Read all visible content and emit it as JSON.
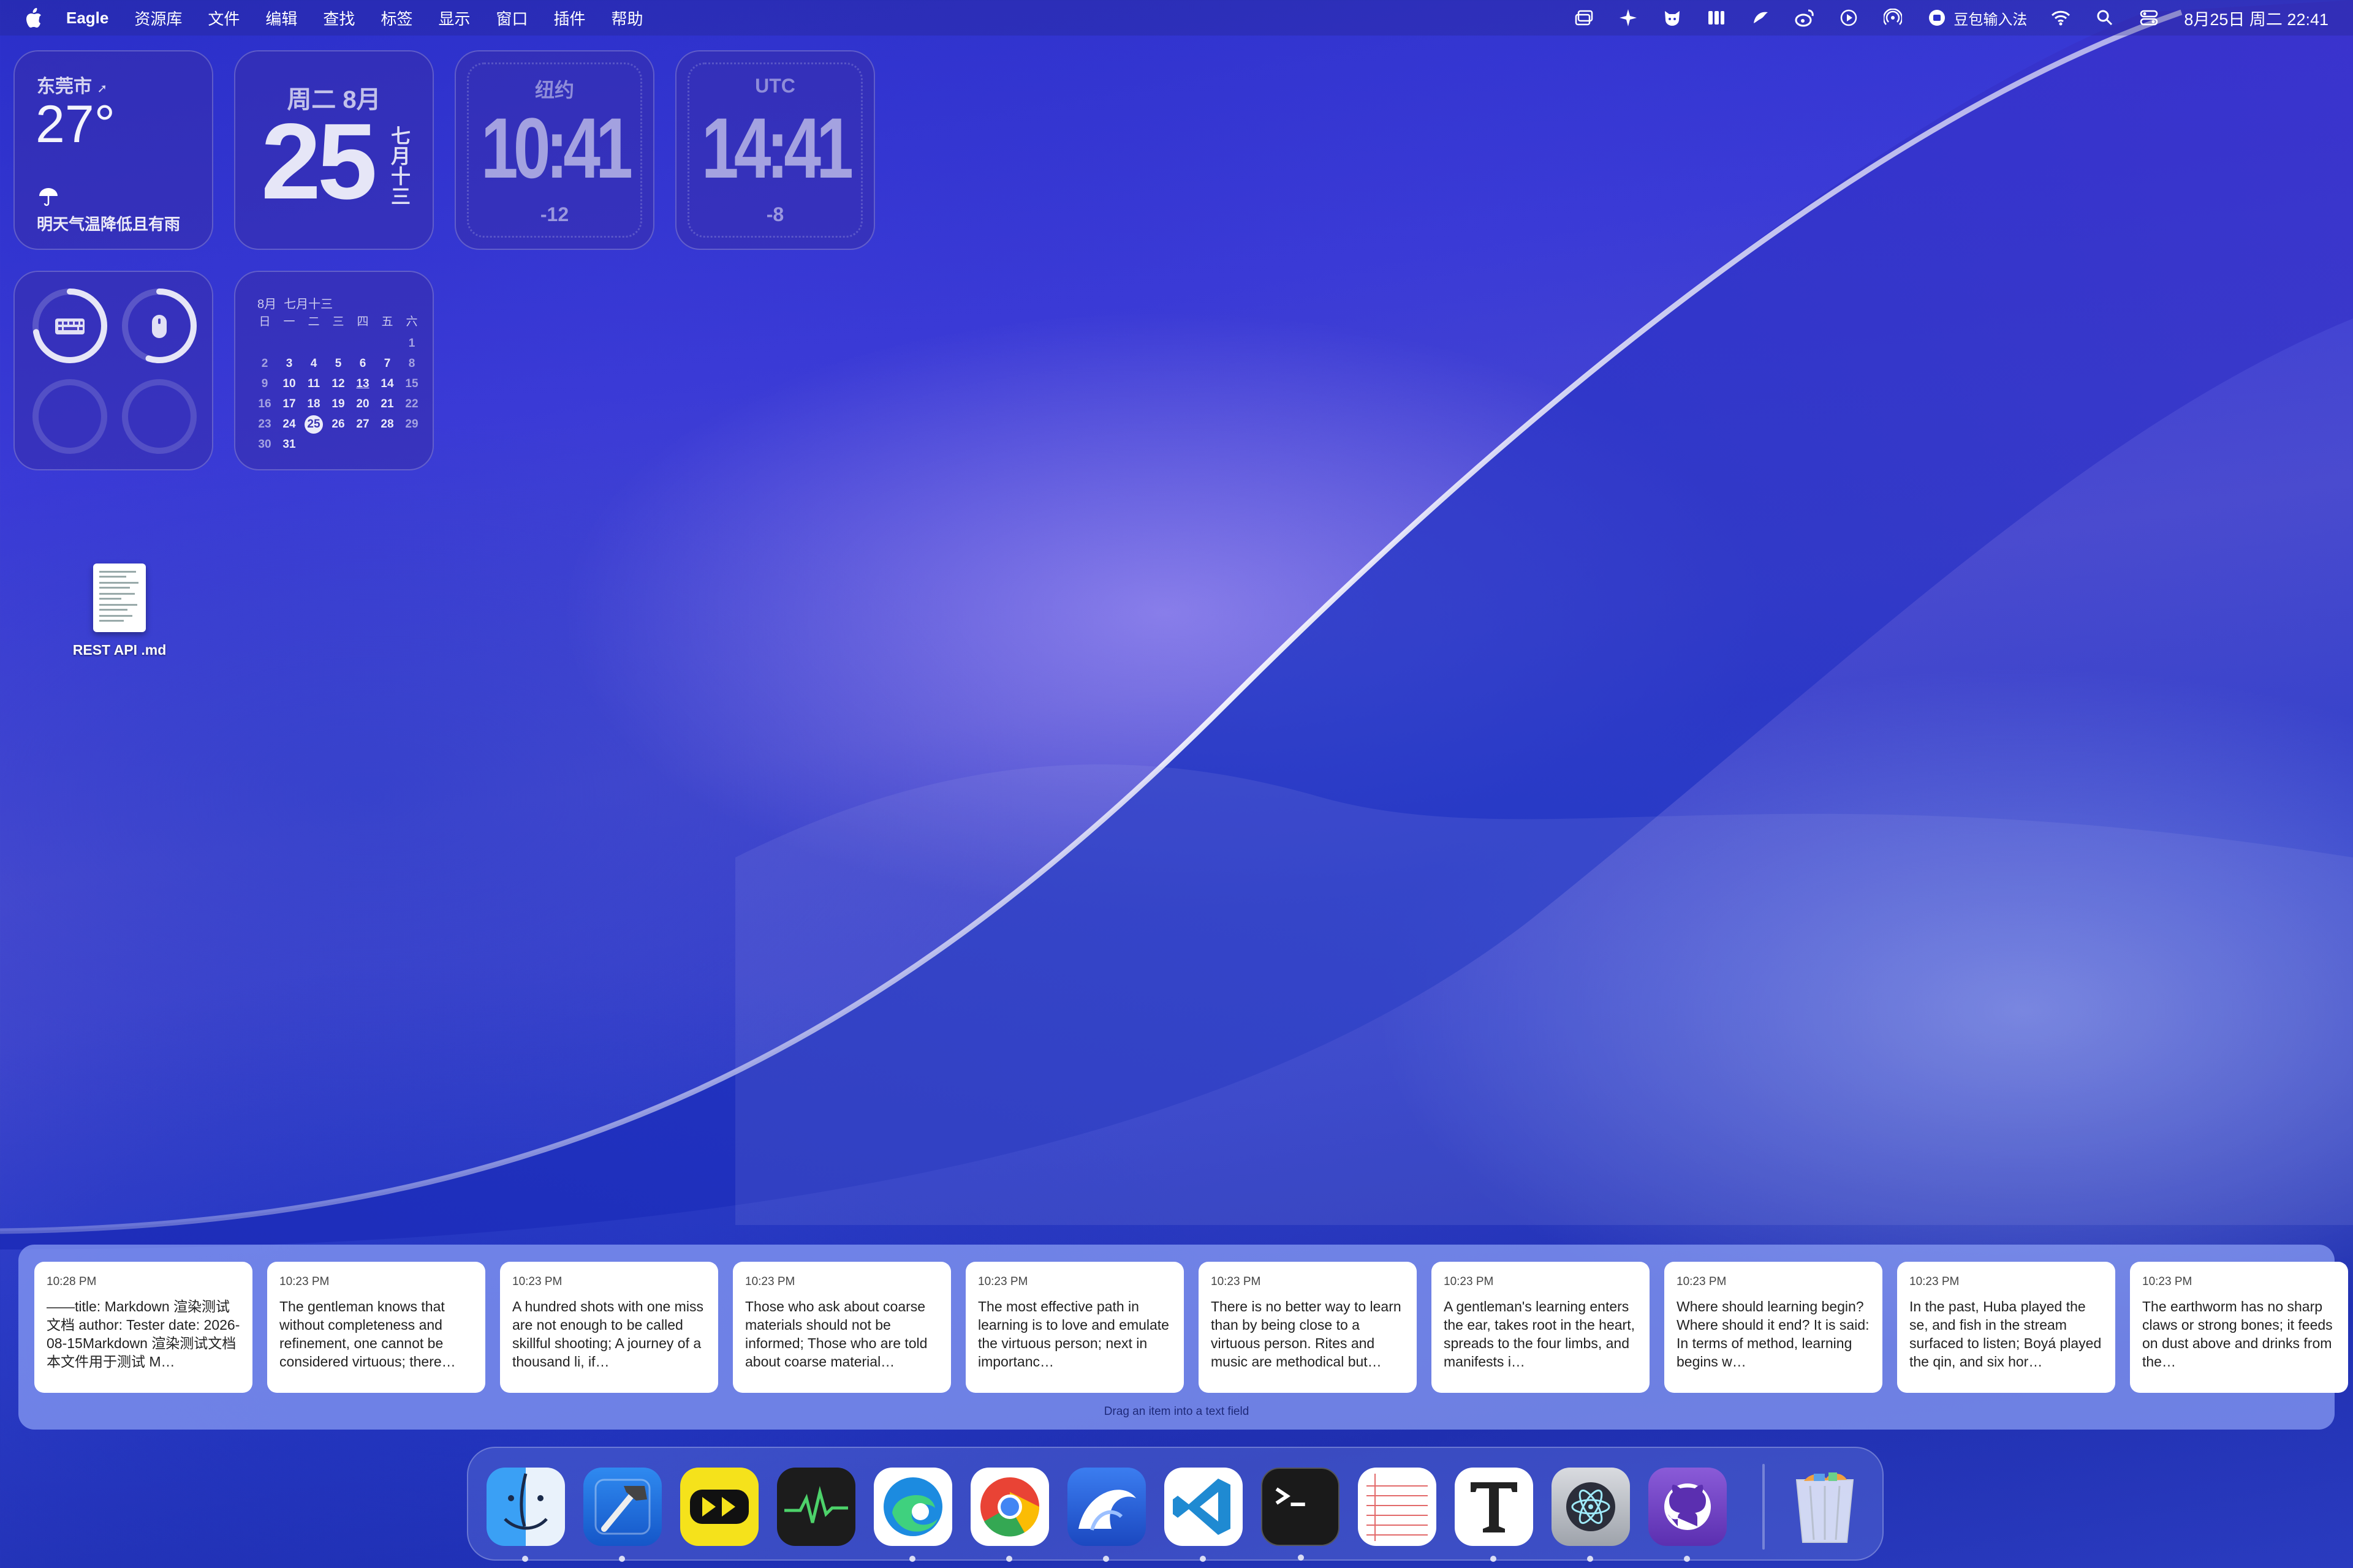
{
  "menubar": {
    "app_name": "Eagle",
    "menus": [
      "资源库",
      "文件",
      "编辑",
      "查找",
      "标签",
      "显示",
      "窗口",
      "插件",
      "帮助"
    ],
    "ime_label": "豆包输入法",
    "clock": "8月25日 周二  22:41"
  },
  "widgets": {
    "weather": {
      "city": "东莞市",
      "temp": "27°",
      "desc": "明天气温降低且有雨"
    },
    "date": {
      "header": "周二 8月",
      "day": "25",
      "lunar": "七月十三"
    },
    "clocks": [
      {
        "label": "纽约",
        "time": "10:41",
        "offset": "-12"
      },
      {
        "label": "UTC",
        "time": "14:41",
        "offset": "-8"
      }
    ],
    "batteries": {
      "keyboard_level": 0.72,
      "mouse_level": 0.55
    },
    "calendar": {
      "month": "8月",
      "lunar": "七月十三",
      "weekdays": [
        "日",
        "一",
        "二",
        "三",
        "四",
        "五",
        "六"
      ],
      "weeks": [
        [
          "",
          "",
          "",
          "",
          "",
          "",
          "1"
        ],
        [
          "2",
          "3",
          "4",
          "5",
          "6",
          "7",
          "8"
        ],
        [
          "9",
          "10",
          "11",
          "12",
          "13",
          "14",
          "15"
        ],
        [
          "16",
          "17",
          "18",
          "19",
          "20",
          "21",
          "22"
        ],
        [
          "23",
          "24",
          "25",
          "26",
          "27",
          "28",
          "29"
        ],
        [
          "30",
          "31",
          "",
          "",
          "",
          "",
          ""
        ]
      ],
      "today": "25",
      "marked": "13"
    }
  },
  "desktop": {
    "file_name": "REST API .md"
  },
  "clipboard": {
    "hint": "Drag an item into a text field",
    "items": [
      {
        "time": "10:28 PM",
        "text": "——title: Markdown 渲染测试文档 author: Tester date: 2026-08-15Markdown 渲染测试文档本文件用于测试 M…"
      },
      {
        "time": "10:23 PM",
        "text": "The gentleman knows that without completeness and refinement, one cannot be considered virtuous; there…"
      },
      {
        "time": "10:23 PM",
        "text": "A hundred shots with one miss are not enough to be called skillful shooting; A journey of a thousand li, if…"
      },
      {
        "time": "10:23 PM",
        "text": "Those who ask about coarse materials should not be informed; Those who are told about coarse material…"
      },
      {
        "time": "10:23 PM",
        "text": "The most effective path in learning is to love and emulate the virtuous person; next in importanc…"
      },
      {
        "time": "10:23 PM",
        "text": "There is no better way to learn than by being close to a virtuous person. Rites and music are methodical but…"
      },
      {
        "time": "10:23 PM",
        "text": "A gentleman's learning enters the ear, takes root in the heart, spreads to the four limbs, and manifests i…"
      },
      {
        "time": "10:23 PM",
        "text": "Where should learning begin? Where should it end? It is said: In terms of method, learning begins w…"
      },
      {
        "time": "10:23 PM",
        "text": "In the past, Huba played the se, and fish in the stream surfaced to listen; Boyá played the qin, and six hor…"
      },
      {
        "time": "10:23 PM",
        "text": "The earthworm has no sharp claws or strong bones; it feeds on dust above and drinks from the…"
      }
    ]
  },
  "dock": {
    "apps": [
      {
        "icon": "finder-icon",
        "running": true
      },
      {
        "icon": "xcode-icon",
        "running": true
      },
      {
        "icon": "media-player-icon",
        "running": false
      },
      {
        "icon": "activity-monitor-icon",
        "running": false
      },
      {
        "icon": "edge-icon",
        "running": true
      },
      {
        "icon": "chrome-icon",
        "running": true
      },
      {
        "icon": "wave-app-icon",
        "running": true
      },
      {
        "icon": "vscode-icon",
        "running": true
      },
      {
        "icon": "terminal-icon",
        "running": true
      },
      {
        "icon": "notes-paper-icon",
        "running": false
      },
      {
        "icon": "typora-icon",
        "running": true
      },
      {
        "icon": "electron-icon",
        "running": true
      },
      {
        "icon": "github-desktop-icon",
        "running": true
      }
    ],
    "trash_icon": "trash-icon",
    "colors": {
      "accent": "#3a33b0"
    }
  }
}
